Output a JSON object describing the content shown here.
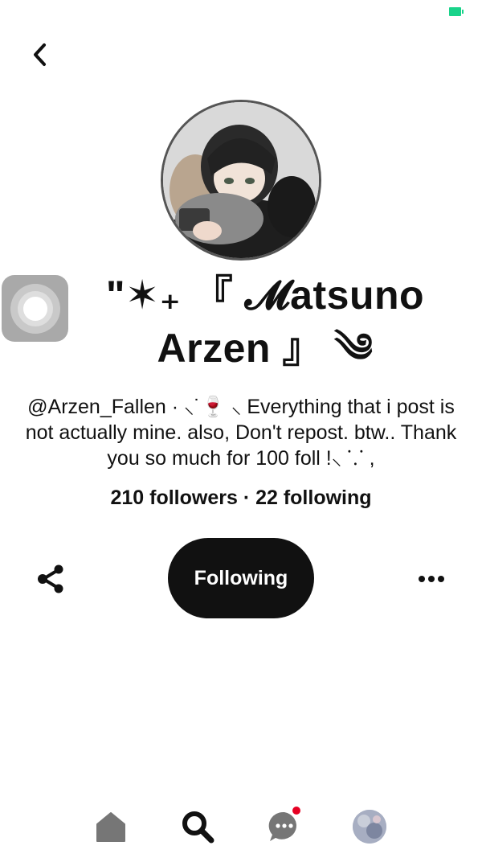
{
  "status_bar": {
    "battery_color": "#19d38a"
  },
  "header": {
    "back_icon": "chevron-left-icon"
  },
  "profile": {
    "display_name_line1": "\"✶₊ 『 𝓜atsuno",
    "display_name_line2": "Arzen 』 ༄",
    "bio": "@Arzen_Fallen · ⸜˙🍷 ⸜ Everything that i post is not actually mine. also, Don't repost. btw.. Thank you so much for 100 foll !⸜ ⸪ ,",
    "stats": "210 followers · 22 following"
  },
  "actions": {
    "share_icon": "share-icon",
    "follow_label": "Following",
    "more_icon": "more-horizontal-icon"
  },
  "bottom_nav": {
    "items": [
      {
        "icon": "home-icon"
      },
      {
        "icon": "search-icon"
      },
      {
        "icon": "messages-icon",
        "has_notification": true
      },
      {
        "icon": "profile-avatar-icon"
      }
    ]
  },
  "colors": {
    "primary_text": "#111111",
    "follow_button_bg": "#111111",
    "notification_dot": "#e60023",
    "nav_icon_inactive": "#767676"
  }
}
